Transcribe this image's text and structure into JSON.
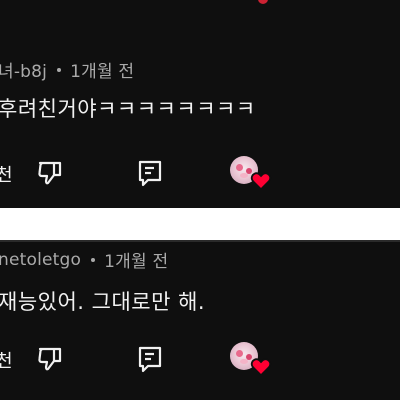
{
  "comments": [
    {
      "author_fragment": "녀-b8j",
      "time": "1개월 전",
      "text": "후려친거야ㅋㅋㅋㅋㅋㅋㅋㅋ",
      "like_label_fragment": "천"
    },
    {
      "author_fragment": "netoletgo",
      "time": "1개월 전",
      "text": "재능있어. 그대로만 해.",
      "like_label_fragment": "천"
    }
  ],
  "colors": {
    "background": "#0f0f0f",
    "separator": "#ffffff",
    "meta_text": "#aaaaaa",
    "main_text": "#f1f1f1",
    "heart": "#ff0033"
  },
  "icons": {
    "dislike": "thumbs-down-icon",
    "reply": "reply-comment-icon",
    "creator_heart": "heart-icon"
  }
}
